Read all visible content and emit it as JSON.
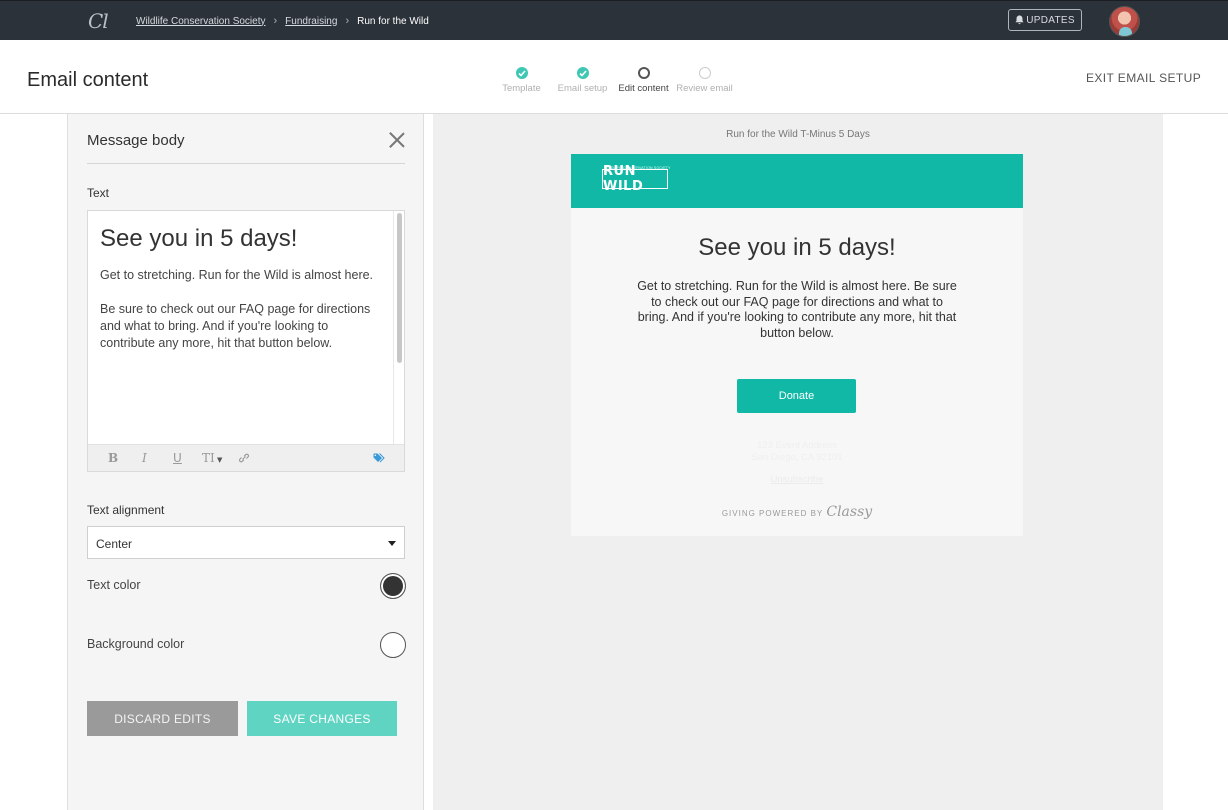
{
  "nav": {
    "logo": "Cl",
    "breadcrumbs": [
      "Wildlife Conservation Society",
      "Fundraising"
    ],
    "current": "Run for the Wild",
    "updates_label": "UPDATES"
  },
  "header": {
    "title": "Email content",
    "steps": [
      {
        "label": "Template",
        "state": "done"
      },
      {
        "label": "Email setup",
        "state": "done"
      },
      {
        "label": "Edit content",
        "state": "current"
      },
      {
        "label": "Review email",
        "state": "todo"
      }
    ],
    "exit_label": "EXIT EMAIL SETUP"
  },
  "panel": {
    "title": "Message body",
    "text_label": "Text",
    "editor": {
      "heading": "See you in 5 days!",
      "paragraph_1": "Get to stretching. Run for the Wild is almost here.",
      "paragraph_2": "Be sure to check out our FAQ page for directions and what to bring. And if you're looking to contribute any more, hit that button below."
    },
    "toolbar": {
      "bold": "B",
      "italic": "I",
      "underline": "U",
      "size": "TI"
    },
    "alignment_label": "Text alignment",
    "alignment_value": "Center",
    "text_color_label": "Text color",
    "bg_color_label": "Background color",
    "text_color": "#333333",
    "bg_color": "#ffffff",
    "discard_label": "DISCARD EDITS",
    "save_label": "SAVE CHANGES"
  },
  "preview": {
    "subject": "Run for the Wild T-Minus 5 Days",
    "banner_color": "#11b8a6",
    "logo_small": "WILDLIFE CONSERVATION SOCIETY",
    "logo_big": "RUN WILD",
    "heading": "See you in 5 days!",
    "body": "Get to stretching. Run for the Wild is almost here. Be sure to check out our FAQ page for directions and what to bring. And if you're looking to contribute any more, hit that button below.",
    "donate_label": "Donate",
    "address_1": "123 Event Address",
    "address_2": "San Diego, CA 92101",
    "unsubscribe": "Unsubscribe",
    "powered_by": "GIVING POWERED BY",
    "brand": "Classy"
  }
}
